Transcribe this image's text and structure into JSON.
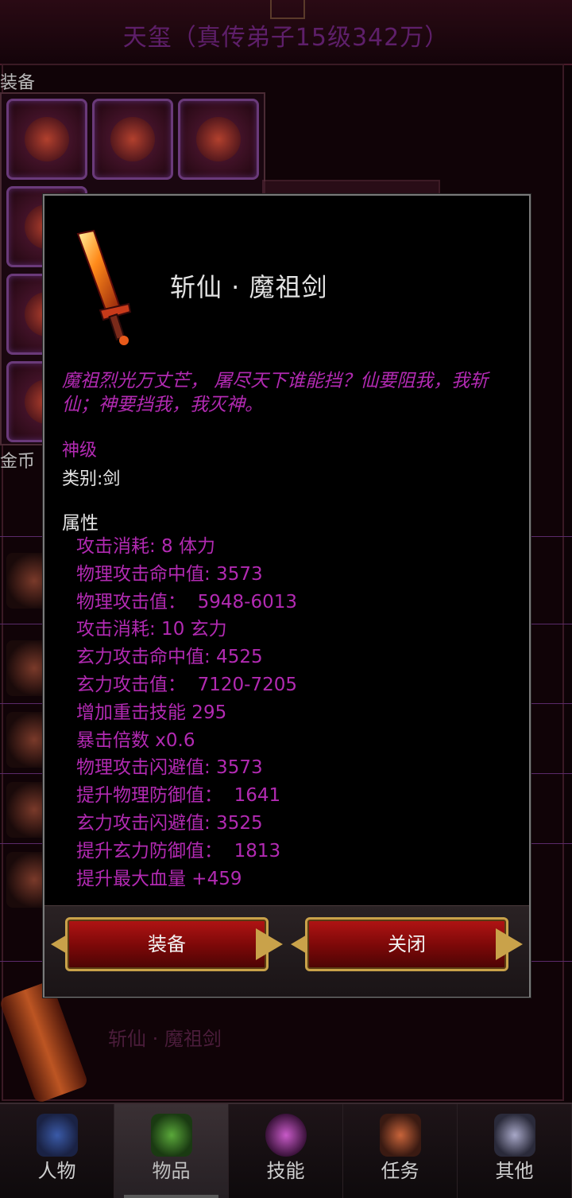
{
  "header": {
    "title": "天玺（真传弟子15级342万）"
  },
  "background": {
    "equipment_label": "装备",
    "gold_label": "金币",
    "ghost_item_name": "斩仙 · 魔祖剑"
  },
  "dialog": {
    "item_name": "斩仙 · 魔祖剑",
    "description": "魔祖烈光万丈芒， 屠尽天下谁能挡？仙要阻我，我斩仙；神要挡我，我灭神。",
    "tier": "神级",
    "category": "类别:剑",
    "attributes_heading": "属性",
    "attributes": [
      "攻击消耗: 8 体力",
      "物理攻击命中值: 3573",
      "物理攻击值：  5948-6013",
      "攻击消耗: 10 玄力",
      "玄力攻击命中值: 4525",
      "玄力攻击值：  7120-7205",
      "增加重击技能 295",
      "暴击倍数 x0.6",
      "物理攻击闪避值: 3573",
      "提升物理防御值：  1641",
      "玄力攻击闪避值: 3525",
      "提升玄力防御值：  1813",
      "提升最大血量 +459"
    ],
    "equip_button": "装备",
    "close_button": "关闭"
  },
  "nav": {
    "tabs": [
      {
        "label": "人物",
        "icon": "character-icon",
        "active": false
      },
      {
        "label": "物品",
        "icon": "items-icon",
        "active": true
      },
      {
        "label": "技能",
        "icon": "skills-icon",
        "active": false
      },
      {
        "label": "任务",
        "icon": "quests-icon",
        "active": false
      },
      {
        "label": "其他",
        "icon": "other-icon",
        "active": false
      }
    ]
  },
  "colors": {
    "attribute_text": "#b22ab2",
    "button_red": "#b21414",
    "button_gold": "#c9a24a"
  }
}
